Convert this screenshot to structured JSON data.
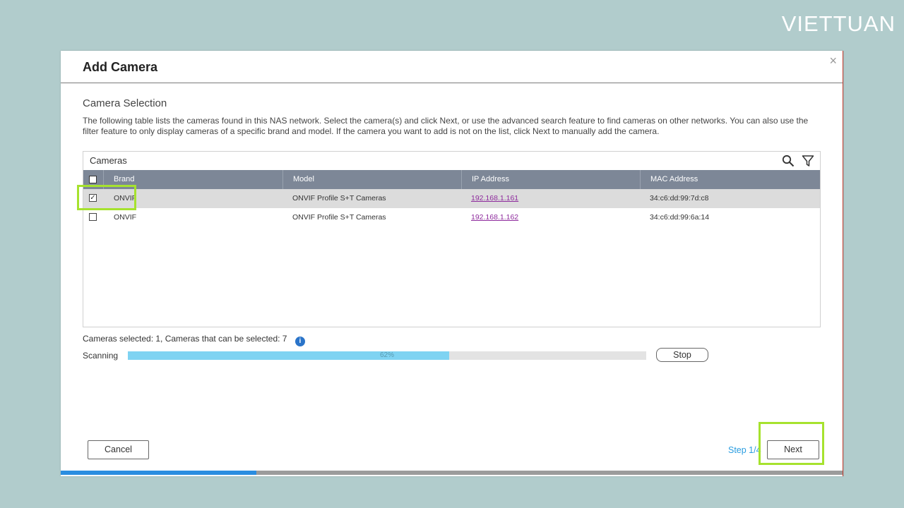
{
  "brand_logo": "VIETTUAN",
  "dialog": {
    "title": "Add Camera",
    "close_glyph": "×",
    "section_title": "Camera Selection",
    "description": "The following table lists the cameras found in this NAS network. Select the camera(s) and click Next, or use the advanced search feature to find cameras on other networks. You can also use the filter feature to only display cameras of a specific brand and model. If the camera you want to add is not on the list, click Next to manually add the camera."
  },
  "table": {
    "caption": "Cameras",
    "icons": [
      "search-icon",
      "filter-icon"
    ],
    "headers": {
      "brand": "Brand",
      "model": "Model",
      "ip": "IP Address",
      "mac": "MAC Address"
    },
    "rows": [
      {
        "checked": true,
        "brand": "ONVIF",
        "model": "ONVIF Profile S+T Cameras",
        "ip": "192.168.1.161",
        "mac": "34:c6:dd:99:7d:c8"
      },
      {
        "checked": false,
        "brand": "ONVIF",
        "model": "ONVIF Profile S+T Cameras",
        "ip": "192.168.1.162",
        "mac": "34:c6:dd:99:6a:14"
      }
    ]
  },
  "summary": {
    "text": "Cameras selected:  1, Cameras that can be selected:  7"
  },
  "scan": {
    "label": "Scanning",
    "percent_text": "62%",
    "fraction": 0.62,
    "stop_label": "Stop"
  },
  "footer": {
    "cancel_label": "Cancel",
    "step_text": "Step 1/4",
    "next_label": "Next",
    "wizard_progress_fraction": 0.25
  },
  "colors": {
    "accent": "#2a8de0",
    "highlight": "#a6e22e",
    "link": "#8e2b9d"
  }
}
